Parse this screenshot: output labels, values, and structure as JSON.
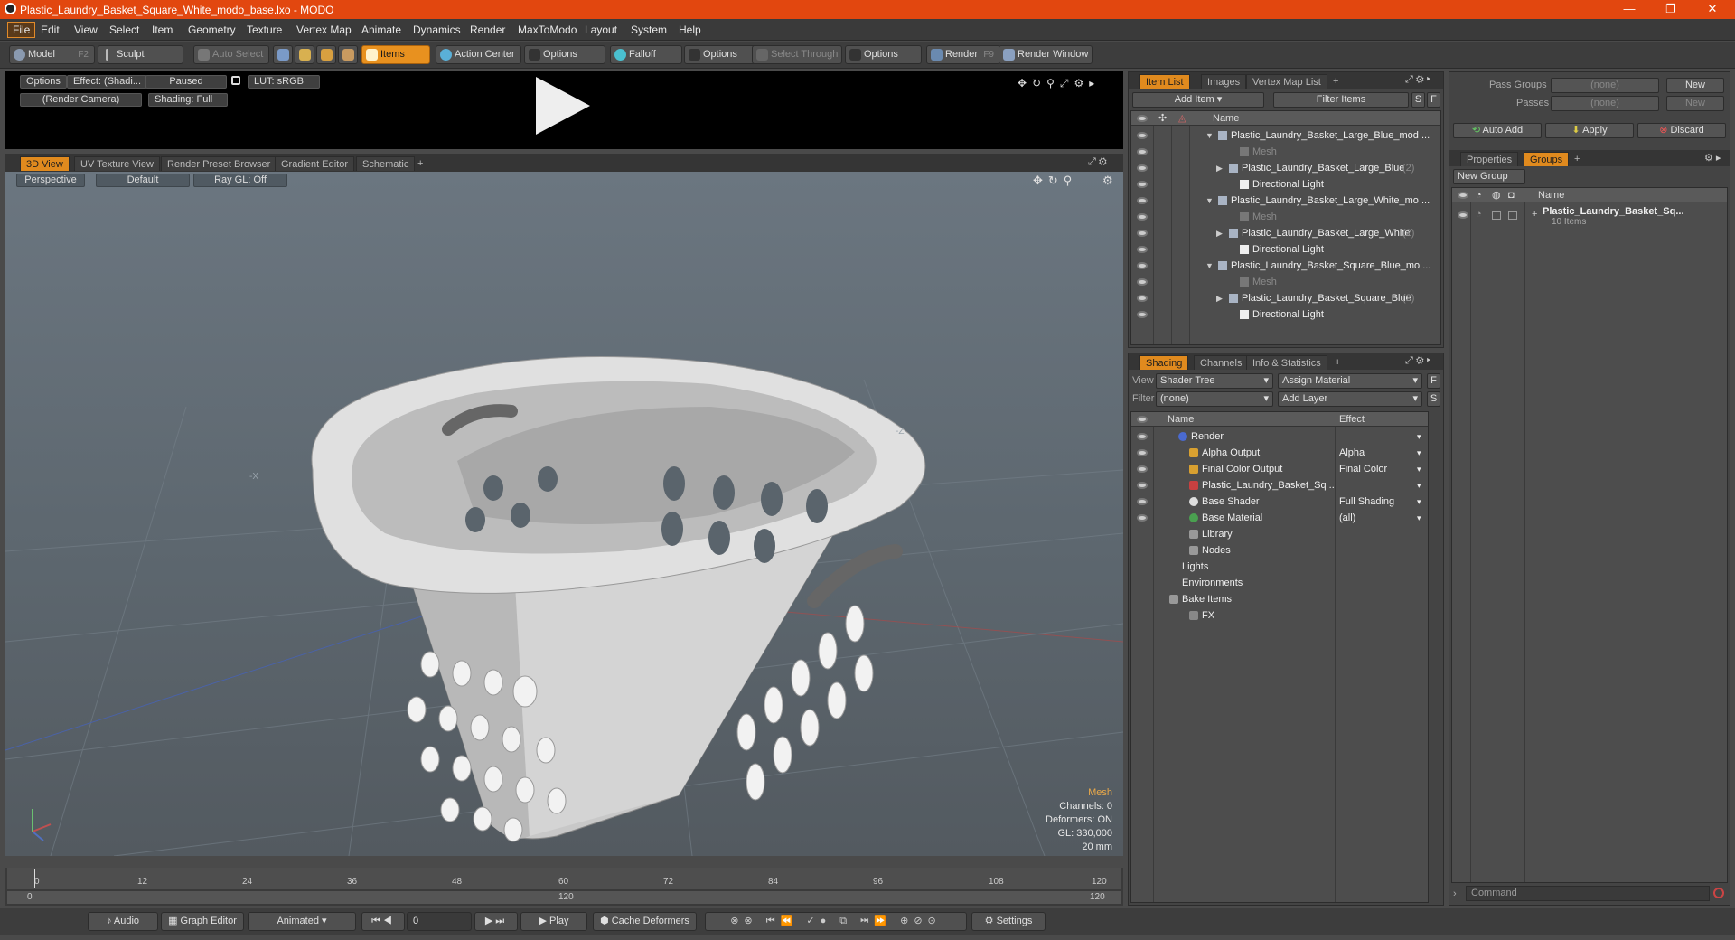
{
  "window": {
    "title": "Plastic_Laundry_Basket_Square_White_modo_base.lxo - MODO",
    "minimize": "—",
    "maximize": "❐",
    "close": "✕"
  },
  "menu": [
    "File",
    "Edit",
    "View",
    "Select",
    "Item",
    "Geometry",
    "Texture",
    "Vertex Map",
    "Animate",
    "Dynamics",
    "Render",
    "MaxToModo",
    "Layout",
    "System",
    "Help"
  ],
  "toolbar": {
    "model": "Model",
    "model_key": "F2",
    "sculpt": "Sculpt",
    "auto_select": "Auto Select",
    "items": "Items",
    "action_center": "Action Center",
    "options1": "Options",
    "falloff": "Falloff",
    "options2": "Options",
    "select_through": "Select Through",
    "options3": "Options",
    "render": "Render",
    "render_key": "F9",
    "render_window": "Render Window"
  },
  "preview": {
    "options": "Options",
    "effect": "Effect: (Shadi...",
    "paused": "Paused",
    "lut": "LUT: sRGB",
    "camera": "(Render Camera)",
    "shading": "Shading: Full"
  },
  "viewport_tabs": [
    "3D View",
    "UV Texture View",
    "Render Preset Browser",
    "Gradient Editor",
    "Schematic",
    "+"
  ],
  "viewport": {
    "perspective": "Perspective",
    "default": "Default",
    "raygl": "Ray GL: Off",
    "axis_x": "-X",
    "axis_z": "-Z"
  },
  "stats": {
    "mesh": "Mesh",
    "channels": "Channels: 0",
    "deformers": "Deformers: ON",
    "gl": "GL: 330,000",
    "size": "20 mm"
  },
  "timeline": {
    "ticks": [
      "0",
      "12",
      "24",
      "36",
      "48",
      "60",
      "72",
      "84",
      "96",
      "108",
      "120"
    ],
    "bottom_left": "0",
    "bottom_mid": "120",
    "bottom_right": "120"
  },
  "bottombar": {
    "audio": "Audio",
    "graph": "Graph Editor",
    "animated": "Animated",
    "frame": "0",
    "play": "Play",
    "cache": "Cache Deformers",
    "settings": "Settings"
  },
  "item_panel": {
    "tabs": [
      "Item List",
      "Images",
      "Vertex Map List",
      "+"
    ],
    "add_item": "Add Item",
    "filter": "Filter Items",
    "s": "S",
    "f": "F",
    "col_name": "Name",
    "rows": [
      {
        "label": "Plastic_Laundry_Basket_Large_Blue_mod ...",
        "count": "",
        "dim": false,
        "indent": 0,
        "arrow": "▼"
      },
      {
        "label": "Mesh",
        "count": "",
        "dim": true,
        "indent": 2,
        "arrow": ""
      },
      {
        "label": "Plastic_Laundry_Basket_Large_Blue",
        "count": "(2)",
        "dim": false,
        "indent": 1,
        "arrow": "▶"
      },
      {
        "label": "Directional Light",
        "count": "",
        "dim": false,
        "indent": 2,
        "arrow": ""
      },
      {
        "label": "Plastic_Laundry_Basket_Large_White_mo ...",
        "count": "",
        "dim": false,
        "indent": 0,
        "arrow": "▼"
      },
      {
        "label": "Mesh",
        "count": "",
        "dim": true,
        "indent": 2,
        "arrow": ""
      },
      {
        "label": "Plastic_Laundry_Basket_Large_White",
        "count": "(2)",
        "dim": false,
        "indent": 1,
        "arrow": "▶"
      },
      {
        "label": "Directional Light",
        "count": "",
        "dim": false,
        "indent": 2,
        "arrow": ""
      },
      {
        "label": "Plastic_Laundry_Basket_Square_Blue_mo ...",
        "count": "",
        "dim": false,
        "indent": 0,
        "arrow": "▼"
      },
      {
        "label": "Mesh",
        "count": "",
        "dim": true,
        "indent": 2,
        "arrow": ""
      },
      {
        "label": "Plastic_Laundry_Basket_Square_Blue",
        "count": "(2)",
        "dim": false,
        "indent": 1,
        "arrow": "▶"
      },
      {
        "label": "Directional Light",
        "count": "",
        "dim": false,
        "indent": 2,
        "arrow": ""
      }
    ]
  },
  "shading_panel": {
    "tabs": [
      "Shading",
      "Channels",
      "Info & Statistics",
      "+"
    ],
    "view_label": "View",
    "view_value": "Shader Tree",
    "assign": "Assign Material",
    "f": "F",
    "filter_label": "Filter",
    "filter_value": "(none)",
    "add_layer": "Add Layer",
    "s": "S",
    "col_name": "Name",
    "col_effect": "Effect",
    "rows": [
      {
        "label": "Render",
        "effect": "",
        "indent": 0,
        "eye": true
      },
      {
        "label": "Alpha Output",
        "effect": "Alpha",
        "indent": 1,
        "eye": true
      },
      {
        "label": "Final Color Output",
        "effect": "Final Color",
        "indent": 1,
        "eye": true
      },
      {
        "label": "Plastic_Laundry_Basket_Sq ...",
        "effect": "",
        "indent": 1,
        "eye": true
      },
      {
        "label": "Base Shader",
        "effect": "Full Shading",
        "indent": 1,
        "eye": true
      },
      {
        "label": "Base Material",
        "effect": "(all)",
        "indent": 1,
        "eye": true
      },
      {
        "label": "Library",
        "effect": "",
        "indent": -1,
        "eye": false
      },
      {
        "label": "Nodes",
        "effect": "",
        "indent": -1,
        "eye": false
      },
      {
        "label": "Lights",
        "effect": "",
        "indent": -2,
        "eye": false
      },
      {
        "label": "Environments",
        "effect": "",
        "indent": -2,
        "eye": false
      },
      {
        "label": "Bake Items",
        "effect": "",
        "indent": -2,
        "eye": false
      },
      {
        "label": "FX",
        "effect": "",
        "indent": -1,
        "eye": false
      }
    ]
  },
  "right_panel": {
    "pass_groups": "Pass Groups",
    "pass_value": "(none)",
    "new": "New",
    "passes": "Passes",
    "passes_value": "(none)",
    "new2": "New",
    "auto_add": "Auto Add",
    "apply": "Apply",
    "discard": "Discard",
    "tabs": [
      "Properties",
      "Groups",
      "+"
    ],
    "new_group": "New Group",
    "col_name": "Name",
    "group_name": "Plastic_Laundry_Basket_Sq...",
    "group_items": "10 Items",
    "command": "Command"
  }
}
